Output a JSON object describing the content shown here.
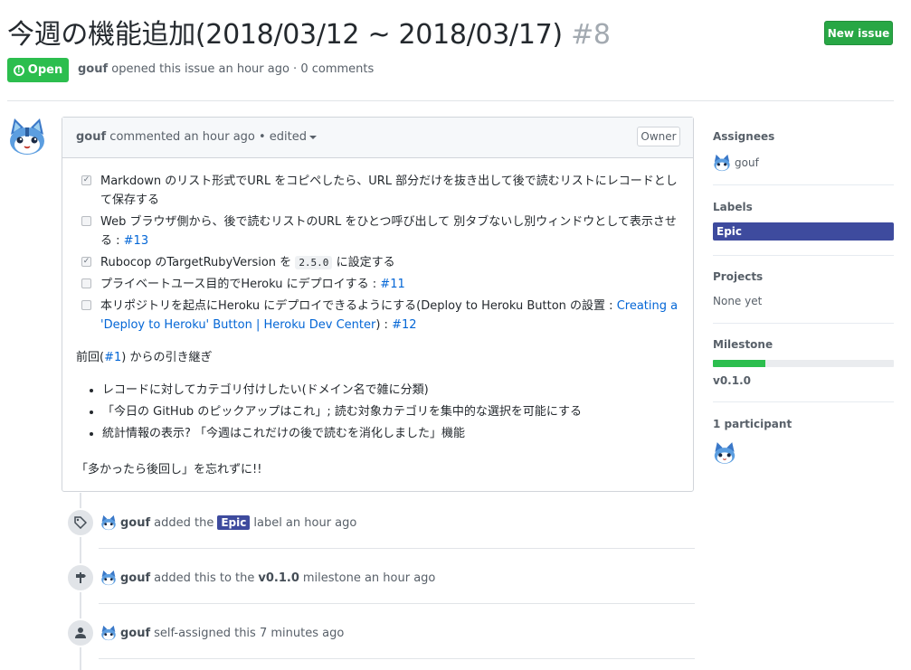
{
  "issue": {
    "title": "今週の機能追加(2018/03/12 ~ 2018/03/17)",
    "number": "#8",
    "state": "Open",
    "author": "gouf",
    "meta_text": "opened this issue an hour ago · 0 comments",
    "new_issue_label": "New issue"
  },
  "comment": {
    "author": "gouf",
    "action": "commented an hour ago • edited",
    "owner_badge": "Owner",
    "tasks": [
      {
        "checked": true,
        "text": "Markdown のリスト形式でURL をコピペしたら、URL 部分だけを抜き出して後で読むリストにレコードとして保存する"
      },
      {
        "checked": false,
        "text": "Web ブラウザ側から、後で読むリストのURL をひとつ呼び出して 別タブないし別ウィンドウとして表示させる :",
        "link": "#13"
      },
      {
        "checked": true,
        "text_before": "Rubocop のTargetRubyVersion を",
        "code": "2.5.0",
        "text_after": "に設定する"
      },
      {
        "checked": false,
        "text": "プライベートユース目的でHeroku にデプロイする :",
        "link": "#11"
      },
      {
        "checked": false,
        "text": "本リポジトリを起点にHeroku にデプロイできるようにする(Deploy to Heroku Button の設置 :",
        "link": "Creating a 'Deploy to Heroku' Button | Heroku Dev Center",
        "after": ") :",
        "link2": "#12"
      }
    ],
    "carry_over_before": "前回(",
    "carry_over_link": "#1",
    "carry_over_after": ") からの引き継ぎ",
    "bullets": [
      "レコードに対してカテゴリ付けしたい(ドメイン名で雑に分類)",
      "「今日の GitHub のピックアップはこれ」; 読む対象カテゴリを集中的な選択を可能にする",
      "統計情報の表示? 「今週はこれだけの後で読むを消化しました」機能"
    ],
    "closing": "「多かったら後回し」を忘れずに!!"
  },
  "timeline": [
    {
      "icon": "tag-icon",
      "user": "gouf",
      "before": "added the",
      "label": "Epic",
      "after": "label an hour ago"
    },
    {
      "icon": "milestone-icon",
      "user": "gouf",
      "before": "added this to the",
      "milestone": "v0.1.0",
      "after": "milestone an hour ago"
    },
    {
      "icon": "person-icon",
      "user": "gouf",
      "text": "self-assigned this 7 minutes ago"
    }
  ],
  "sidebar": {
    "assignees_title": "Assignees",
    "assignee": "gouf",
    "labels_title": "Labels",
    "label": "Epic",
    "label_color": "#3e4b9e",
    "projects_title": "Projects",
    "projects_value": "None yet",
    "milestone_title": "Milestone",
    "milestone_progress": 0.29,
    "milestone_value": "v0.1.0",
    "participants_title": "1 participant"
  },
  "colors": {
    "open_green": "#2cbe4e",
    "button_green": "#28a745",
    "link_blue": "#0366d6"
  }
}
